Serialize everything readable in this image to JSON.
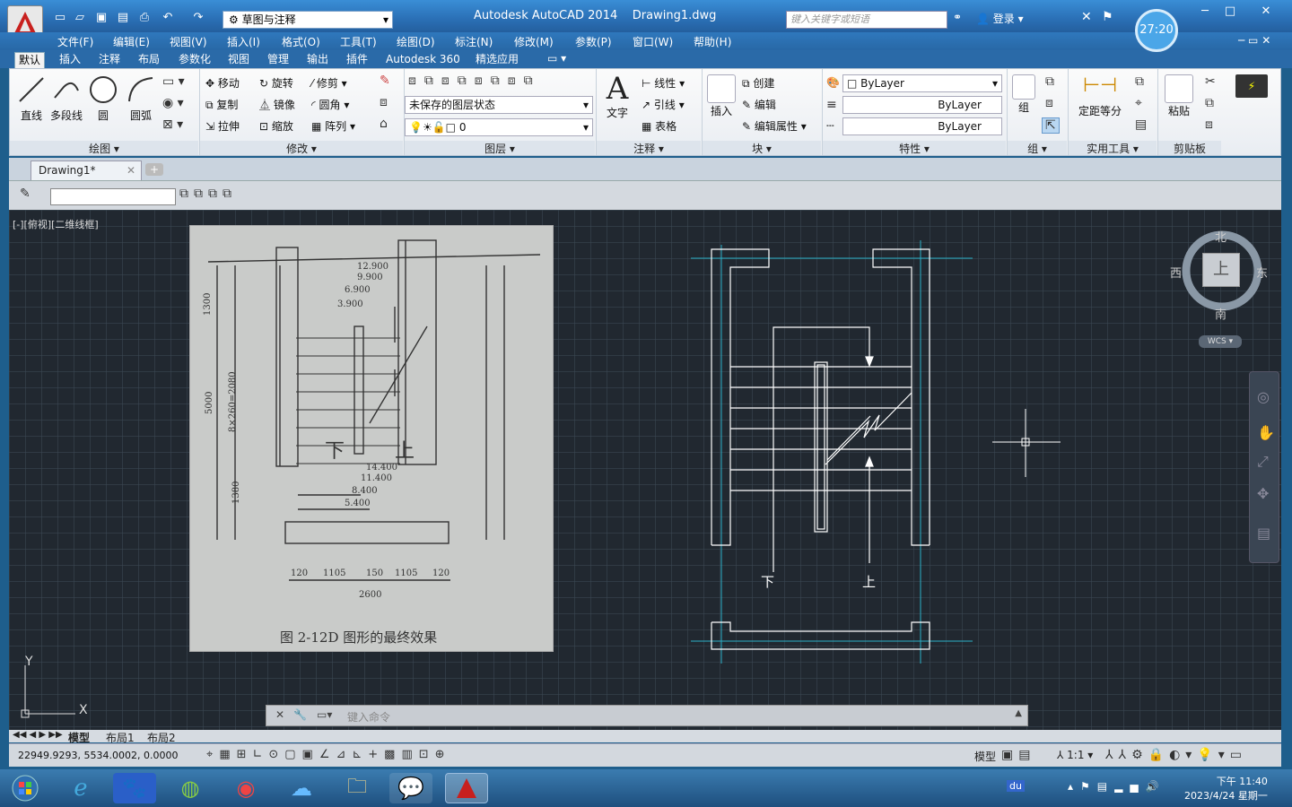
{
  "title_bar": {
    "workspace": "草图与注释",
    "app_title": "Autodesk AutoCAD 2014",
    "doc_title": "Drawing1.dwg",
    "search_placeholder": "键入关键字或短语",
    "login": "登录",
    "timer": "27:20"
  },
  "menu": [
    "文件(F)",
    "编辑(E)",
    "视图(V)",
    "插入(I)",
    "格式(O)",
    "工具(T)",
    "绘图(D)",
    "标注(N)",
    "修改(M)",
    "参数(P)",
    "窗口(W)",
    "帮助(H)"
  ],
  "ribbon_tabs": [
    "默认",
    "插入",
    "注释",
    "布局",
    "参数化",
    "视图",
    "管理",
    "输出",
    "插件",
    "Autodesk 360",
    "精选应用"
  ],
  "ribbon": {
    "draw": {
      "title": "绘图",
      "line": "直线",
      "polyline": "多段线",
      "circle": "圆",
      "arc": "圆弧"
    },
    "modify": {
      "title": "修改",
      "move": "移动",
      "rotate": "旋转",
      "trim": "修剪",
      "copy": "复制",
      "mirror": "镜像",
      "fillet": "圆角",
      "stretch": "拉伸",
      "scale": "缩放",
      "array": "阵列"
    },
    "layers": {
      "title": "图层",
      "state": "未保存的图层状态",
      "current": "0"
    },
    "annotation": {
      "title": "注释",
      "text": "文字",
      "linear": "线性",
      "leader": "引线",
      "table": "表格"
    },
    "block": {
      "title": "块",
      "insert": "插入",
      "create": "创建",
      "edit": "编辑",
      "edit_attr": "编辑属性"
    },
    "properties": {
      "title": "特性",
      "color": "ByLayer",
      "linetype": "ByLayer",
      "lineweight": "ByLayer"
    },
    "groups": {
      "title": "组",
      "group": "组"
    },
    "utilities": {
      "title": "实用工具",
      "measure": "定距等分"
    },
    "clipboard": {
      "title": "剪贴板",
      "paste": "粘贴"
    }
  },
  "doc_tab": "Drawing1*",
  "viewport_label": "[-][俯视][二维线框]",
  "photo": {
    "caption": "图 2-12D   图形的最终效果",
    "dims": [
      "12.900",
      "9.900",
      "6.900",
      "3.900",
      "14.400",
      "11.400",
      "8.400",
      "5.400",
      "1300",
      "8×260=2080",
      "5000",
      "1380",
      "120",
      "1105",
      "150",
      "1105",
      "120",
      "2600",
      "下",
      "上"
    ]
  },
  "drawing": {
    "down": "下",
    "up": "上"
  },
  "nav_cube": {
    "north": "北",
    "south": "南",
    "west": "西",
    "east": "东",
    "top": "上",
    "wcs": "WCS"
  },
  "command_placeholder": "键入命令",
  "layout_tabs": [
    "模型",
    "布局1",
    "布局2"
  ],
  "status": {
    "coords": "22949.9293, 5534.0002, 0.0000",
    "model": "模型",
    "scale": "1:1"
  },
  "taskbar": {
    "time": "下午 11:40",
    "date": "2023/4/24 星期一"
  },
  "colors": {
    "canvas": "#212830",
    "accent": "#2a6fb5",
    "cyan_line": "#2ab0c8"
  }
}
